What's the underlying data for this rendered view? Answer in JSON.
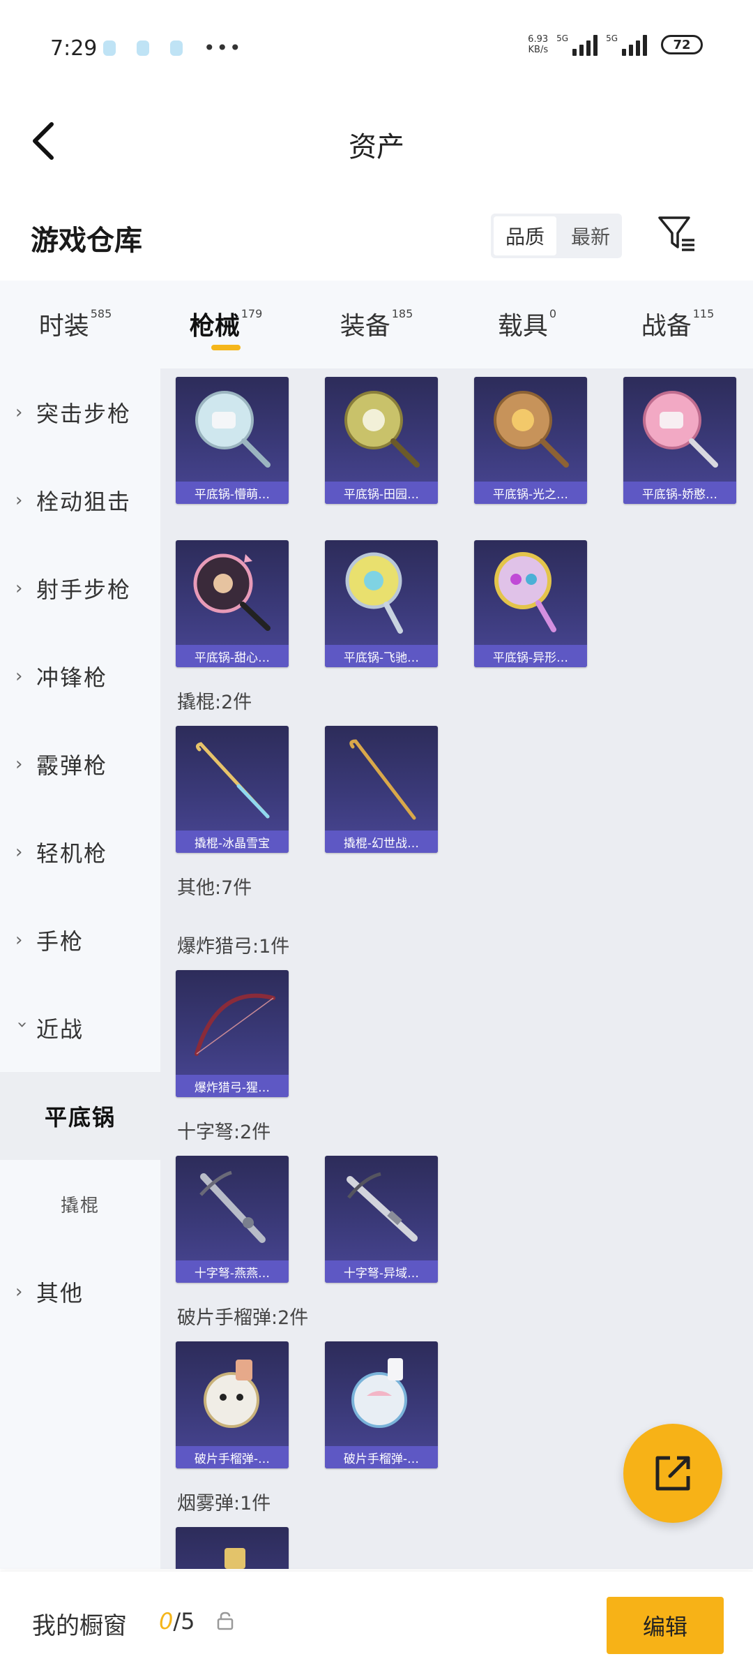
{
  "status_bar": {
    "time": "7:29",
    "net_speed_value": "6.93",
    "net_speed_unit": "KB/s",
    "signal1_label": "5G",
    "signal2_label": "5G",
    "battery": "72"
  },
  "header": {
    "title": "资产"
  },
  "warehouse": {
    "title": "游戏仓库",
    "sort_quality": "品质",
    "sort_newest": "最新"
  },
  "tabs": [
    {
      "label": "时装",
      "count": "585"
    },
    {
      "label": "枪械",
      "count": "179"
    },
    {
      "label": "装备",
      "count": "185"
    },
    {
      "label": "载具",
      "count": "0"
    },
    {
      "label": "战备",
      "count": "115"
    }
  ],
  "sidebar": {
    "items": [
      {
        "label": "突击步枪"
      },
      {
        "label": "栓动狙击"
      },
      {
        "label": "射手步枪"
      },
      {
        "label": "冲锋枪"
      },
      {
        "label": "霰弹枪"
      },
      {
        "label": "轻机枪"
      },
      {
        "label": "手枪"
      },
      {
        "label": "近战"
      },
      {
        "label": "平底锅"
      },
      {
        "label": "撬棍"
      },
      {
        "label": "其他"
      }
    ]
  },
  "content": {
    "pans": [
      {
        "label": "平底锅-懵萌…"
      },
      {
        "label": "平底锅-田园…"
      },
      {
        "label": "平底锅-光之…"
      },
      {
        "label": "平底锅-娇憨…"
      },
      {
        "label": "平底锅-甜心…"
      },
      {
        "label": "平底锅-飞驰…"
      },
      {
        "label": "平底锅-异形…"
      }
    ],
    "crowbar_header": "撬棍:2件",
    "crowbars": [
      {
        "label": "撬棍-冰晶雪宝"
      },
      {
        "label": "撬棍-幻世战…"
      }
    ],
    "other_header": "其他:7件",
    "bow_header": "爆炸猎弓:1件",
    "bows": [
      {
        "label": "爆炸猎弓-猩…"
      }
    ],
    "crossbow_header": "十字弩:2件",
    "crossbows": [
      {
        "label": "十字弩-燕燕…"
      },
      {
        "label": "十字弩-异域…"
      }
    ],
    "frag_header": "破片手榴弹:2件",
    "frags": [
      {
        "label": "破片手榴弹-…"
      },
      {
        "label": "破片手榴弹-…"
      }
    ],
    "smoke_header": "烟雾弹:1件"
  },
  "bottom_bar": {
    "showcase_label": "我的橱窗",
    "showcase_current": "0",
    "showcase_total": "/5",
    "edit_label": "编辑"
  },
  "colors": {
    "accent": "#f7b217",
    "card_label": "#5e58c4",
    "card_bg": "#3b3a7a"
  }
}
